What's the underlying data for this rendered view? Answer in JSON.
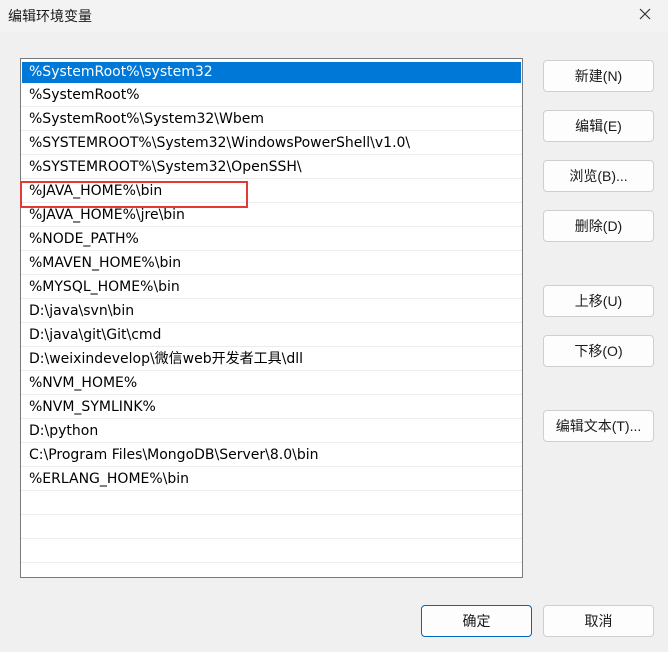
{
  "window": {
    "title": "编辑环境变量"
  },
  "paths": [
    "%SystemRoot%\\system32",
    "%SystemRoot%",
    "%SystemRoot%\\System32\\Wbem",
    "%SYSTEMROOT%\\System32\\WindowsPowerShell\\v1.0\\",
    "%SYSTEMROOT%\\System32\\OpenSSH\\",
    "%JAVA_HOME%\\bin",
    "%JAVA_HOME%\\jre\\bin",
    "%NODE_PATH%",
    "%MAVEN_HOME%\\bin",
    "%MYSQL_HOME%\\bin",
    "D:\\java\\svn\\bin",
    "D:\\java\\git\\Git\\cmd",
    "D:\\weixindevelop\\微信web开发者工具\\dll",
    "%NVM_HOME%",
    "%NVM_SYMLINK%",
    "D:\\python",
    "C:\\Program Files\\MongoDB\\Server\\8.0\\bin",
    "%ERLANG_HOME%\\bin"
  ],
  "selected_index": 0,
  "highlighted_index": 5,
  "buttons": {
    "new": "新建(N)",
    "edit": "编辑(E)",
    "browse": "浏览(B)...",
    "delete": "删除(D)",
    "move_up": "上移(U)",
    "move_down": "下移(O)",
    "edit_text": "编辑文本(T)...",
    "ok": "确定",
    "cancel": "取消"
  },
  "colors": {
    "selection": "#0078d7",
    "highlight_border": "#e53935",
    "ok_border": "#0067c0"
  },
  "icons": {
    "close": "close-icon"
  }
}
